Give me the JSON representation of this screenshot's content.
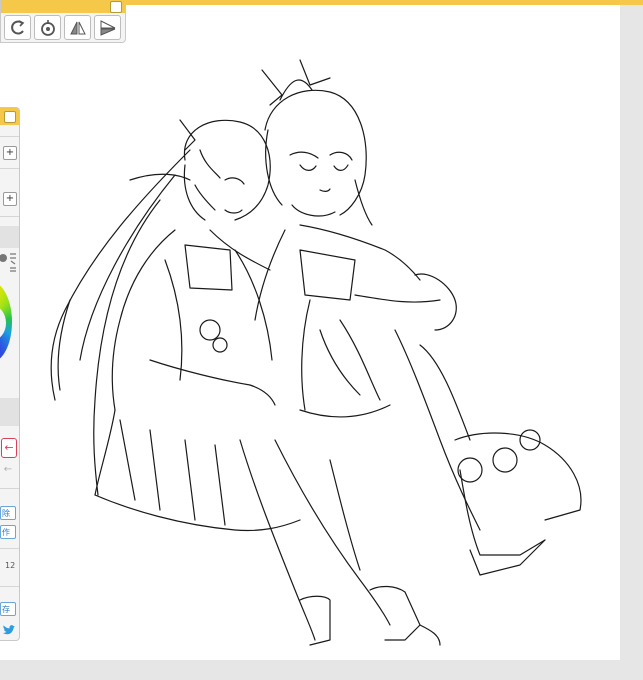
{
  "status_bar": {
    "left_text": "",
    "right_text": ""
  },
  "toolbar": {
    "tools": [
      {
        "name": "rotate-left-icon"
      },
      {
        "name": "reset-rotation-icon"
      },
      {
        "name": "flip-horizontal-icon"
      },
      {
        "name": "flip-vertical-icon"
      }
    ]
  },
  "side_panel": {
    "plus_1": "+",
    "plus_2": "+",
    "back_arrow": "←",
    "forward_arrow": "←",
    "delete_button_label": "除",
    "action_button_label": "作",
    "size_value": "12",
    "save_button_label": "存"
  },
  "colors": {
    "accent": "#f5c84a",
    "undo": "#d9435a",
    "link": "#2f78c0"
  }
}
